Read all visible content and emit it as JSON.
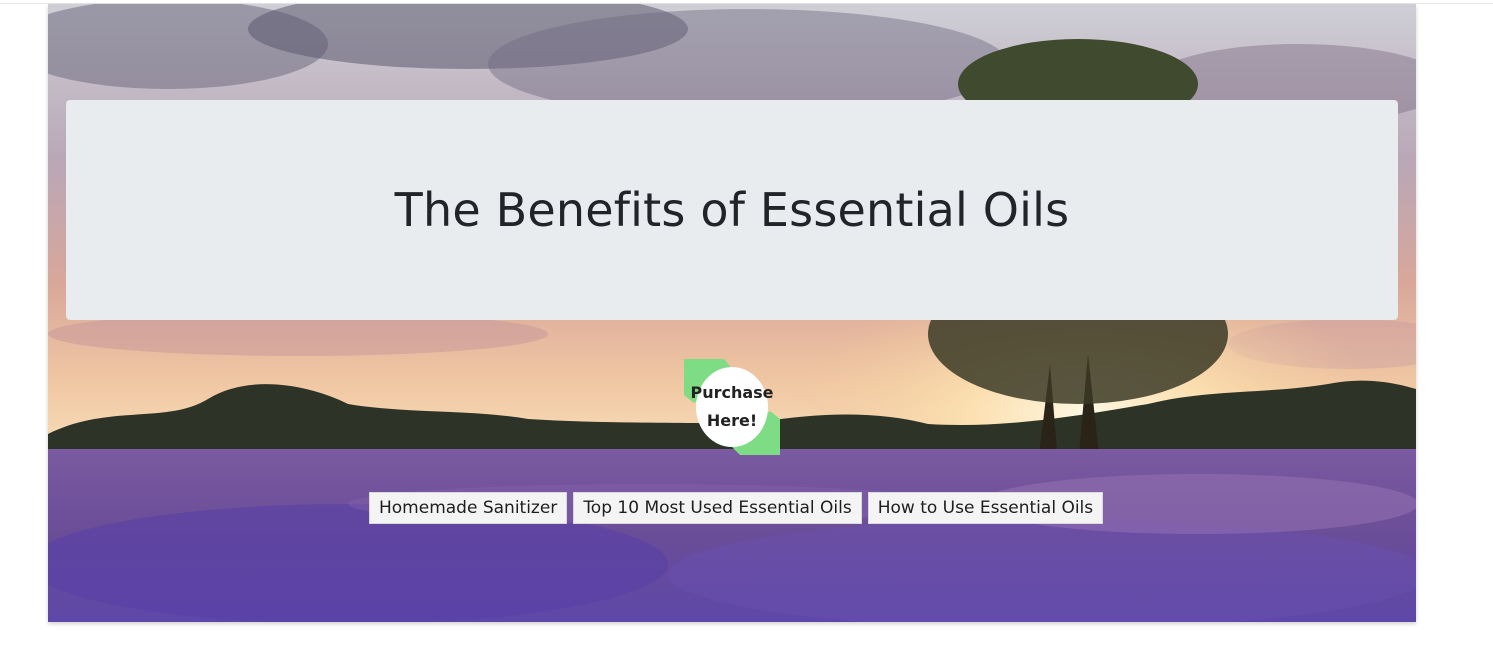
{
  "header": {
    "title": "The Benefits of Essential Oils"
  },
  "purchase": {
    "label": "Purchase Here!",
    "accent_color": "#7ddc84"
  },
  "nav": {
    "buttons": [
      {
        "label": "Homemade Sanitizer"
      },
      {
        "label": "Top 10 Most Used Essential Oils"
      },
      {
        "label": "How to Use Essential Oils"
      }
    ]
  },
  "background": {
    "scene": "lavender-field-sunset-image"
  }
}
